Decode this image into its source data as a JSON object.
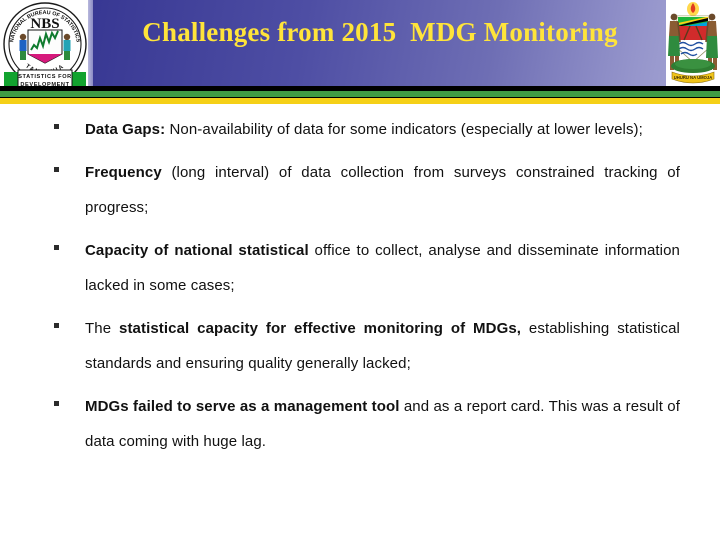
{
  "header": {
    "title": "Challenges from 2015  MDG Monitoring",
    "title_color": "#ffe43a",
    "gradient_from": "#2d2d8c",
    "gradient_to": "#a9a9d6",
    "band_green": "#3f9c44",
    "band_yellow": "#f5d017",
    "left_logo": {
      "name": "nbs-tanzania-logo",
      "ring_text_top": "NATIONAL BUREAU OF STATISTICS",
      "ring_text_bottom": "TANZANIA",
      "acronym": "NBS",
      "tagline_line1": "STATISTICS FOR",
      "tagline_line2": "DEVELOPMENT"
    },
    "right_logo": {
      "name": "tanzania-coat-of-arms"
    }
  },
  "body": {
    "bullets": [
      {
        "bold": "Data Gaps:",
        "rest": " Non-availability of data for some indicators (especially at lower levels);"
      },
      {
        "bold": "Frequency",
        "rest": " (long interval) of data collection from surveys constrained tracking of progress;"
      },
      {
        "bold": "Capacity of national statistical",
        "rest": " office to collect, analyse and disseminate information lacked in some cases;"
      },
      {
        "lead": "The ",
        "bold": "statistical capacity for effective monitoring of MDGs,",
        "rest": " establishing statistical standards and ensuring quality generally lacked;"
      },
      {
        "bold": "MDGs failed to serve as a management tool",
        "rest": " and as a report card. This was a result of data coming with huge lag."
      }
    ]
  }
}
